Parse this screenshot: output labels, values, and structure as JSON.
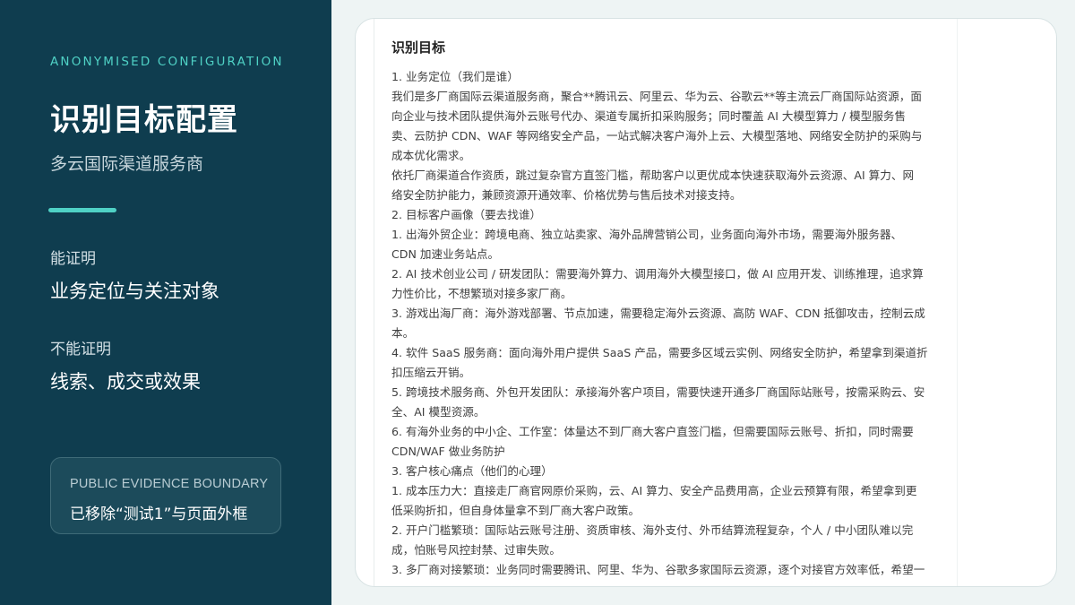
{
  "sidebar": {
    "eyebrow": "ANONYMISED CONFIGURATION",
    "title": "识别目标配置",
    "subtitle": "多云国际渠道服务商",
    "can_prove_label": "能证明",
    "can_prove_value": "业务定位与关注对象",
    "cannot_prove_label": "不能证明",
    "cannot_prove_value": "线索、成交或效果",
    "boundary": {
      "eyebrow": "PUBLIC EVIDENCE BOUNDARY",
      "text": "已移除“测试1”与页面外框"
    }
  },
  "document": {
    "title": "识别目标",
    "lines": [
      "1. 业务定位（我们是谁）",
      "我们是多厂商国际云渠道服务商，聚合**腾讯云、阿里云、华为云、谷歌云**等主流云厂商国际站资源，面",
      "向企业与技术团队提供海外云账号代办、渠道专属折扣采购服务；同时覆盖 AI 大模型算力 / 模型服务售",
      "卖、云防护 CDN、WAF 等网络安全产品，一站式解决客户海外上云、大模型落地、网络安全防护的采购与",
      "成本优化需求。",
      "依托厂商渠道合作资质，跳过复杂官方直签门槛，帮助客户以更优成本快速获取海外云资源、AI 算力、网",
      "络安全防护能力，兼顾资源开通效率、价格优势与售后技术对接支持。",
      "2. 目标客户画像（要去找谁）",
      "1. 出海外贸企业：跨境电商、独立站卖家、海外品牌营销公司，业务面向海外市场，需要海外服务器、",
      "CDN 加速业务站点。",
      "2. AI 技术创业公司 / 研发团队：需要海外算力、调用海外大模型接口，做 AI 应用开发、训练推理，追求算",
      "力性价比，不想繁琐对接多家厂商。",
      "3. 游戏出海厂商：海外游戏部署、节点加速，需要稳定海外云资源、高防 WAF、CDN 抵御攻击，控制云成",
      "本。",
      "4. 软件 SaaS 服务商：面向海外用户提供 SaaS 产品，需要多区域云实例、网络安全防护，希望拿到渠道折",
      "扣压缩云开销。",
      "5. 跨境技术服务商、外包开发团队：承接海外客户项目，需要快速开通多厂商国际站账号，按需采购云、安",
      "全、AI 模型资源。",
      "6. 有海外业务的中小企、工作室：体量达不到厂商大客户直签门槛，但需要国际云账号、折扣，同时需要",
      "CDN/WAF 做业务防护",
      "3. 客户核心痛点（他们的心理）",
      "1. 成本压力大：直接走厂商官网原价采购，云、AI 算力、安全产品费用高，企业云预算有限，希望拿到更",
      "低采购折扣，但自身体量拿不到厂商大客户政策。",
      "2. 开户门槛繁琐：国际站云账号注册、资质审核、海外支付、外币结算流程复杂，个人 / 中小团队难以完",
      "成，怕账号风控封禁、过审失败。",
      "3. 多厂商对接繁琐：业务同时需要腾讯、阿里、华为、谷歌多家国际云资源，逐个对接官方效率低，希望一"
    ]
  }
}
